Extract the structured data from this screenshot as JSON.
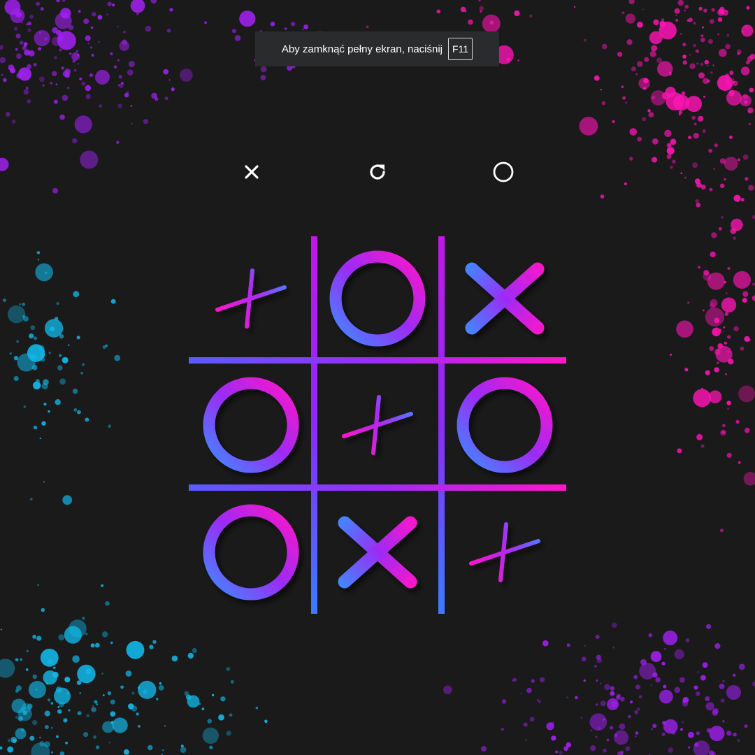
{
  "fullscreen_notice": {
    "text": "Aby zamknąć pełny ekran, naciśnij",
    "key": "F11"
  },
  "controls": [
    {
      "name": "x-player",
      "icon": "x-icon"
    },
    {
      "name": "restart",
      "icon": "restart-icon"
    },
    {
      "name": "o-player",
      "icon": "o-icon"
    }
  ],
  "board": {
    "cells": [
      "+",
      "O",
      "X",
      "O",
      "+",
      "O",
      "O",
      "X",
      "+"
    ]
  },
  "colors": {
    "background": "#1a1a1b",
    "notice_bg": "#2a2b2d",
    "gradient_blue": "#3d8bff",
    "gradient_purple": "#9b2cf5",
    "gradient_magenta": "#ff16c8",
    "splatter_cyan": "#12b7e8",
    "splatter_purple": "#a020f0",
    "splatter_pink": "#ff14b4"
  }
}
